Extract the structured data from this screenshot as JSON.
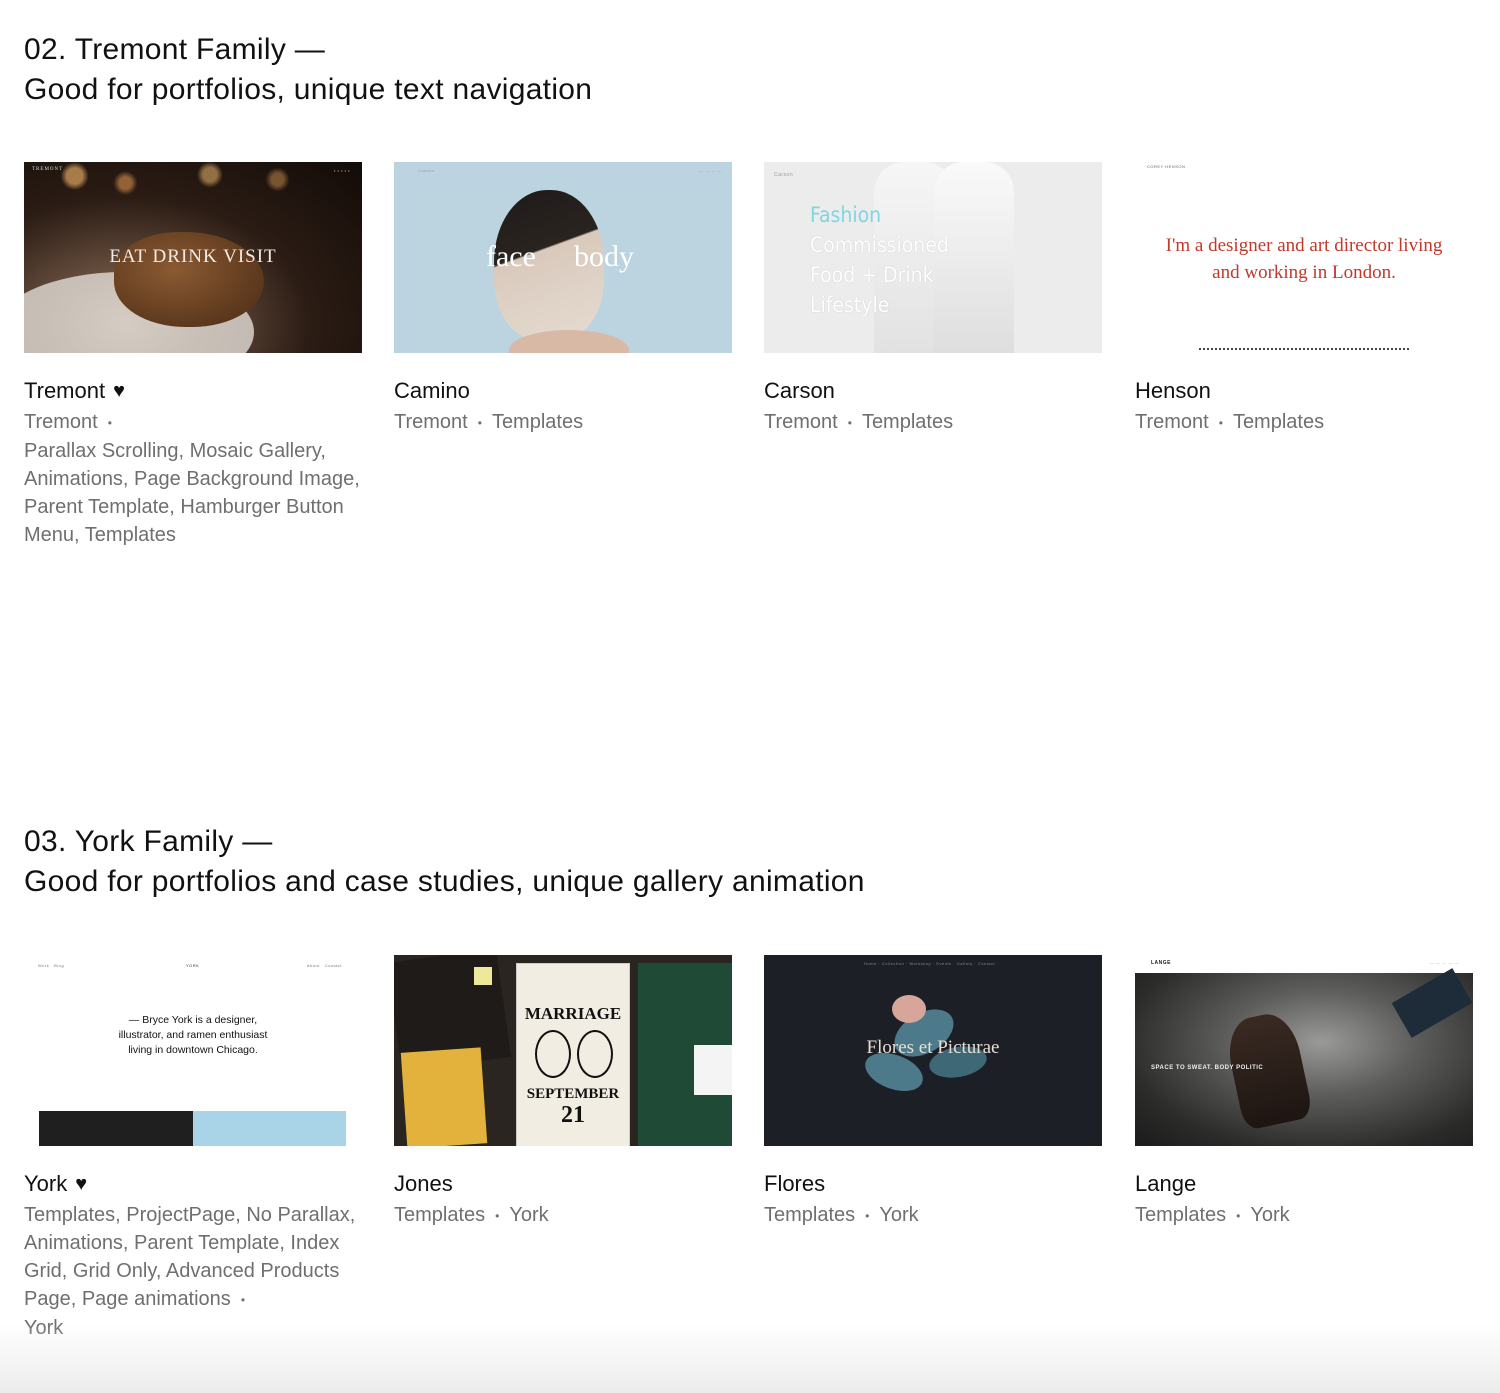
{
  "tremont_section": {
    "title_line1": "02. Tremont Family —",
    "title_line2": "Good for portfolios, unique text navigation",
    "cards": [
      {
        "name": "Tremont",
        "favorite": true,
        "meta_links": [
          "Tremont"
        ],
        "meta_text": "Parallax Scrolling, Mosaic Gallery, Animations, Page Background Image, Parent Template, Hamburger Button Menu, Templates",
        "thumb_logo": "TREMONT",
        "thumb_text": "EAT DRINK VISIT"
      },
      {
        "name": "Camino",
        "favorite": false,
        "meta_links": [
          "Tremont",
          "Templates"
        ],
        "thumb_text_left": "face",
        "thumb_text_right": "body"
      },
      {
        "name": "Carson",
        "favorite": false,
        "meta_links": [
          "Tremont",
          "Templates"
        ],
        "thumb_logo": "Carson",
        "thumb_lines": [
          "Fashion",
          "Commissioned",
          "Food + Drink",
          "Lifestyle"
        ]
      },
      {
        "name": "Henson",
        "favorite": false,
        "meta_links": [
          "Tremont",
          "Templates"
        ],
        "thumb_logo": "COREY HENSON",
        "thumb_text": "I'm a designer and art director living and working in London."
      }
    ]
  },
  "york_section": {
    "title_line1": "03. York Family —",
    "title_line2": "Good for portfolios and case studies, unique gallery animation",
    "cards": [
      {
        "name": "York",
        "favorite": true,
        "meta_text": "Templates, ProjectPage, No Parallax, Animations, Parent Template, Index Grid, Grid Only, Advanced Products Page, Page animations",
        "meta_links": [
          "York"
        ],
        "thumb_logo": "YORK",
        "thumb_text": "— Bryce York is a designer, illustrator, and ramen enthusiast living in downtown Chicago."
      },
      {
        "name": "Jones",
        "favorite": false,
        "meta_links": [
          "Templates",
          "York"
        ],
        "thumb_lines": [
          "MARRIAGE",
          "SEPTEMBER",
          "21"
        ]
      },
      {
        "name": "Flores",
        "favorite": false,
        "meta_links": [
          "Templates",
          "York"
        ],
        "thumb_text": "Flores et Picturae"
      },
      {
        "name": "Lange",
        "favorite": false,
        "meta_links": [
          "Templates",
          "York"
        ],
        "thumb_logo": "LANGE",
        "thumb_text": "SPACE TO SWEAT. BODY POLITIC"
      }
    ]
  },
  "colors": {
    "meta_gray": "#6f6f6f",
    "henson_red": "#c0392b",
    "carson_cyan": "#7fd6df",
    "camino_blue": "#bcd4df",
    "flores_bg": "#1c1f26",
    "york_blue": "#a9d3e6"
  },
  "icons": {
    "favorite": "heart-icon"
  }
}
